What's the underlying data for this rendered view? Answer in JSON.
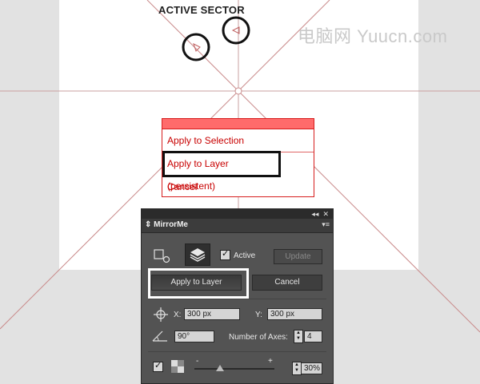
{
  "annotation": {
    "active_sector": "ACTIVE SECTOR"
  },
  "watermark": "电脑网 Yuucn.com",
  "context_menu": {
    "items": [
      "Apply to Selection",
      "Apply to Layer (persistent)",
      "Cancel"
    ]
  },
  "panel": {
    "collapse_glyph": "◂◂",
    "close_glyph": "✕",
    "title": "MirrorMe",
    "active_label": "Active",
    "active_checked": true,
    "update_label": "Update",
    "apply_layer_label": "Apply to Layer",
    "cancel_label": "Cancel",
    "x_label": "X:",
    "x_value": "300 px",
    "y_label": "Y:",
    "y_value": "300 px",
    "angle_value": "90°",
    "axes_label": "Number of Axes:",
    "axes_value": "4",
    "slider_min_label": "-",
    "slider_max_label": "+",
    "opacity_value": "30%"
  },
  "colors": {
    "accent_red": "#d61d1d",
    "guide": "#c98a8a",
    "panel_bg": "#535353"
  }
}
